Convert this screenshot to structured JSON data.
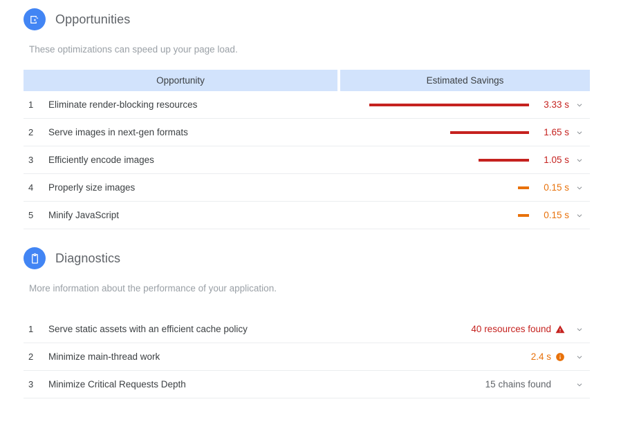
{
  "opportunities": {
    "icon": "opportunity-image-sparkle-icon",
    "title": "Opportunities",
    "description": "These optimizations can speed up your page load.",
    "columns": {
      "name": "Opportunity",
      "savings": "Estimated Savings"
    },
    "rows": [
      {
        "index": "1",
        "title": "Eliminate render-blocking resources",
        "savings_label": "3.33 s",
        "savings_seconds": 3.33,
        "severity": "error",
        "bar_color": "#c5221f",
        "chevron": "chevron-down-icon"
      },
      {
        "index": "2",
        "title": "Serve images in next-gen formats",
        "savings_label": "1.65 s",
        "savings_seconds": 1.65,
        "severity": "error",
        "bar_color": "#c5221f",
        "chevron": "chevron-down-icon"
      },
      {
        "index": "3",
        "title": "Efficiently encode images",
        "savings_label": "1.05 s",
        "savings_seconds": 1.05,
        "severity": "error",
        "bar_color": "#c5221f",
        "chevron": "chevron-down-icon"
      },
      {
        "index": "4",
        "title": "Properly size images",
        "savings_label": "0.15 s",
        "savings_seconds": 0.15,
        "severity": "warn",
        "bar_color": "#e8710a",
        "chevron": "chevron-down-icon"
      },
      {
        "index": "5",
        "title": "Minify JavaScript",
        "savings_label": "0.15 s",
        "savings_seconds": 0.15,
        "severity": "warn",
        "bar_color": "#e8710a",
        "chevron": "chevron-down-icon"
      }
    ]
  },
  "diagnostics": {
    "icon": "clipboard-icon",
    "title": "Diagnostics",
    "description": "More information about the performance of your application.",
    "rows": [
      {
        "index": "1",
        "title": "Serve static assets with an efficient cache policy",
        "value": "40 resources found",
        "severity": "error",
        "badge": "warning-triangle-icon",
        "badge_color": "#c5221f",
        "chevron": "chevron-down-icon"
      },
      {
        "index": "2",
        "title": "Minimize main-thread work",
        "value": "2.4 s",
        "severity": "warn",
        "badge": "info-circle-icon",
        "badge_color": "#e8710a",
        "chevron": "chevron-down-icon"
      },
      {
        "index": "3",
        "title": "Minimize Critical Requests Depth",
        "value": "15 chains found",
        "severity": "none",
        "badge": "",
        "badge_color": "",
        "chevron": "chevron-down-icon"
      }
    ]
  }
}
